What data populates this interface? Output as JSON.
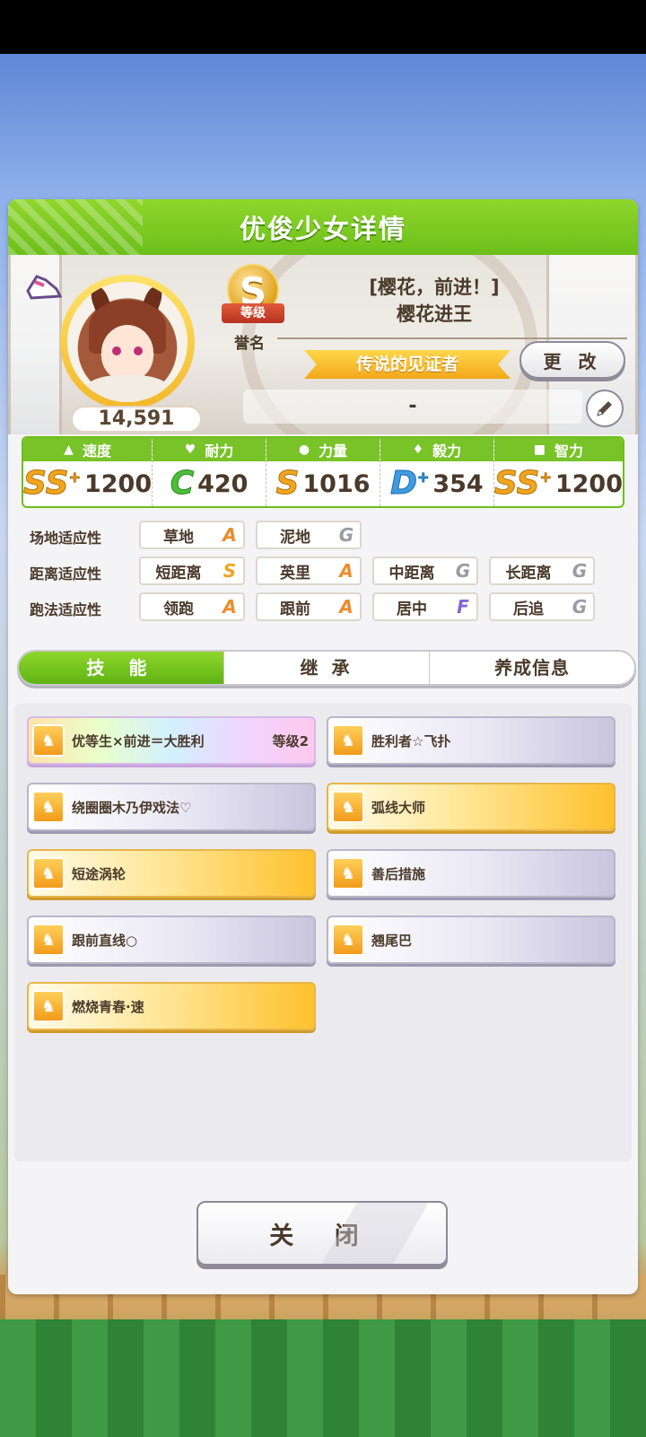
{
  "window": {
    "title": "优俊少女详情"
  },
  "profile": {
    "fans": "14,591",
    "rank": {
      "letter": "S",
      "ribbon": "等级",
      "caption": "誉名"
    },
    "honor_title": "[樱花，前进！]",
    "trainer_name": "樱花进王",
    "badge_title": "传说的见证者",
    "change_label": "更 改",
    "comment": "-"
  },
  "stats": [
    {
      "name": "速度",
      "icon": "shoe-icon",
      "grade": "SS",
      "grade_plus": true,
      "value": "1200"
    },
    {
      "name": "耐力",
      "icon": "heart-icon",
      "grade": "C",
      "grade_plus": false,
      "value": "420"
    },
    {
      "name": "力量",
      "icon": "arm-icon",
      "grade": "S",
      "grade_plus": false,
      "value": "1016"
    },
    {
      "name": "毅力",
      "icon": "flame-icon",
      "grade": "D",
      "grade_plus": true,
      "value": "354"
    },
    {
      "name": "智力",
      "icon": "cap-icon",
      "grade": "SS",
      "grade_plus": true,
      "value": "1200"
    }
  ],
  "aptitudes": [
    {
      "label": "场地适应性",
      "items": [
        {
          "name": "草地",
          "grade": "A"
        },
        {
          "name": "泥地",
          "grade": "G"
        }
      ]
    },
    {
      "label": "距离适应性",
      "items": [
        {
          "name": "短距离",
          "grade": "S"
        },
        {
          "name": "英里",
          "grade": "A"
        },
        {
          "name": "中距离",
          "grade": "G"
        },
        {
          "name": "长距离",
          "grade": "G"
        }
      ]
    },
    {
      "label": "跑法适应性",
      "items": [
        {
          "name": "领跑",
          "grade": "A"
        },
        {
          "name": "跟前",
          "grade": "A"
        },
        {
          "name": "居中",
          "grade": "F"
        },
        {
          "name": "后追",
          "grade": "G"
        }
      ]
    }
  ],
  "tabs": [
    "技 能",
    "继 承",
    "养成信息"
  ],
  "skills": [
    {
      "name": "优等生×前进＝大胜利",
      "level": "等级2",
      "style": "rainbow"
    },
    {
      "name": "胜利者☆飞扑",
      "level": "",
      "style": "normal"
    },
    {
      "name": "绕圈圈木乃伊戏法♡",
      "level": "",
      "style": "normal"
    },
    {
      "name": "弧线大师",
      "level": "",
      "style": "gold"
    },
    {
      "name": "短途涡轮",
      "level": "",
      "style": "gold"
    },
    {
      "name": "善后措施",
      "level": "",
      "style": "normal"
    },
    {
      "name": "跟前直线○",
      "level": "",
      "style": "normal"
    },
    {
      "name": "翘尾巴",
      "level": "",
      "style": "normal"
    },
    {
      "name": "燃烧青春·速",
      "level": "",
      "style": "gold"
    }
  ],
  "close_label": "关 闭"
}
